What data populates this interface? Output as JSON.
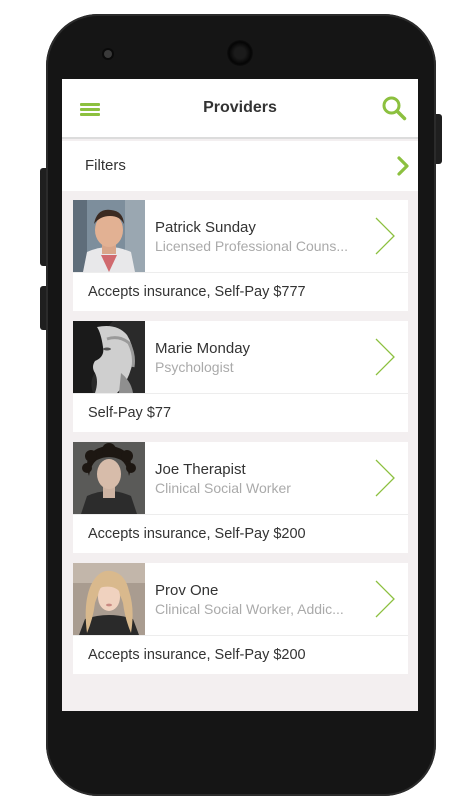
{
  "header": {
    "title": "Providers"
  },
  "filters": {
    "label": "Filters"
  },
  "providers": [
    {
      "name": "Patrick Sunday",
      "role": "Licensed Professional Couns...",
      "pricing": "Accepts insurance, Self-Pay $777"
    },
    {
      "name": "Marie Monday",
      "role": "Psychologist",
      "pricing": "Self-Pay $77"
    },
    {
      "name": "Joe Therapist",
      "role": "Clinical Social Worker",
      "pricing": "Accepts insurance, Self-Pay $200"
    },
    {
      "name": "Prov One",
      "role": "Clinical Social Worker, Addic...",
      "pricing": "Accepts insurance, Self-Pay $200"
    }
  ],
  "colors": {
    "accent": "#8cc03f",
    "background": "#f3eff0"
  },
  "icons": [
    "menu-icon",
    "search-icon",
    "chevron-right-icon"
  ]
}
